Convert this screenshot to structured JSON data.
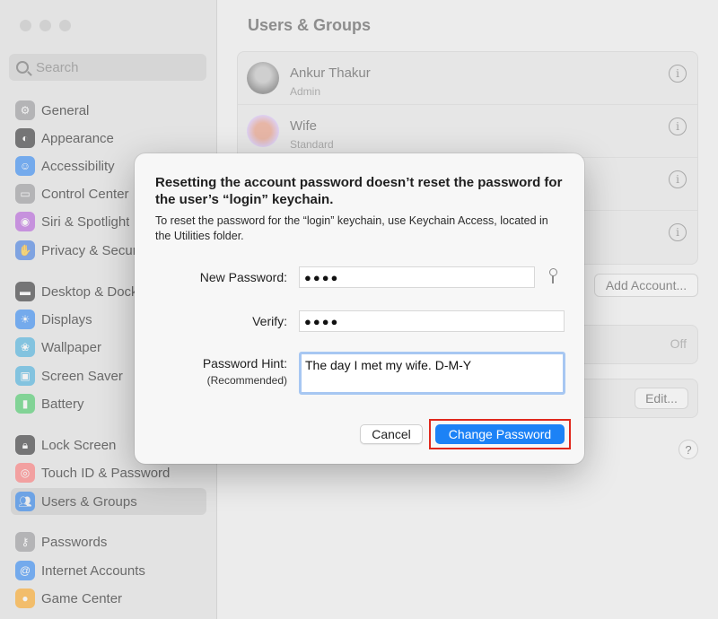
{
  "search": {
    "placeholder": "Search"
  },
  "sidebar": {
    "items": [
      {
        "label": "General",
        "icon": "gear-icon",
        "color": "#8e8e93",
        "active": false
      },
      {
        "label": "Appearance",
        "icon": "appearance-icon",
        "color": "#1c1c1e",
        "active": false
      },
      {
        "label": "Accessibility",
        "icon": "accessibility-icon",
        "color": "#1a7cf5",
        "active": false
      },
      {
        "label": "Control Center",
        "icon": "control-center-icon",
        "color": "#8e8e93",
        "active": false
      },
      {
        "label": "Siri & Spotlight",
        "icon": "siri-icon",
        "color": "#b04fd9",
        "active": false
      },
      {
        "label": "Privacy & Security",
        "icon": "hand-icon",
        "color": "#2f6fe0",
        "active": false
      },
      {
        "label": "Desktop & Dock",
        "icon": "dock-icon",
        "color": "#1c1c1e",
        "active": false
      },
      {
        "label": "Displays",
        "icon": "displays-icon",
        "color": "#1a7cf5",
        "active": false
      },
      {
        "label": "Wallpaper",
        "icon": "wallpaper-icon",
        "color": "#35aadc",
        "active": false
      },
      {
        "label": "Screen Saver",
        "icon": "screen-saver-icon",
        "color": "#35aadc",
        "active": false
      },
      {
        "label": "Battery",
        "icon": "battery-icon",
        "color": "#34c759",
        "active": false
      },
      {
        "label": "Lock Screen",
        "icon": "lock-icon",
        "color": "#1c1c1e",
        "active": false
      },
      {
        "label": "Touch ID & Password",
        "icon": "fingerprint-icon",
        "color": "#ff6b6b",
        "active": false
      },
      {
        "label": "Users & Groups",
        "icon": "users-icon",
        "color": "#1a7cf5",
        "active": true
      },
      {
        "label": "Passwords",
        "icon": "key-icon",
        "color": "#8e8e93",
        "active": false
      },
      {
        "label": "Internet Accounts",
        "icon": "at-icon",
        "color": "#1a7cf5",
        "active": false
      },
      {
        "label": "Game Center",
        "icon": "game-center-icon",
        "color": "#ff9f0a",
        "active": false
      }
    ]
  },
  "main": {
    "title": "Users & Groups",
    "users": [
      {
        "name": "Ankur Thakur",
        "role": "Admin"
      },
      {
        "name": "Wife",
        "role": "Standard"
      },
      {
        "name": "",
        "role": ""
      },
      {
        "name": "",
        "role": ""
      }
    ],
    "add_account_label": "Add Account...",
    "off_label": "Off",
    "edit_label": "Edit...",
    "help_label": "?"
  },
  "dialog": {
    "title": "Resetting the account password doesn’t reset the password for the user’s “login” keychain.",
    "message": "To reset the password for the “login” keychain, use Keychain Access, located in the Utilities folder.",
    "new_password_label": "New Password:",
    "new_password_value": "●●●●",
    "verify_label": "Verify:",
    "verify_value": "●●●●",
    "hint_label": "Password Hint:",
    "hint_sublabel": "(Recommended)",
    "hint_value": "The day I met my wife. D-M-Y",
    "cancel_label": "Cancel",
    "change_label": "Change Password"
  },
  "colors": {
    "accent": "#1c82f6",
    "highlight_box": "#e0281c"
  }
}
